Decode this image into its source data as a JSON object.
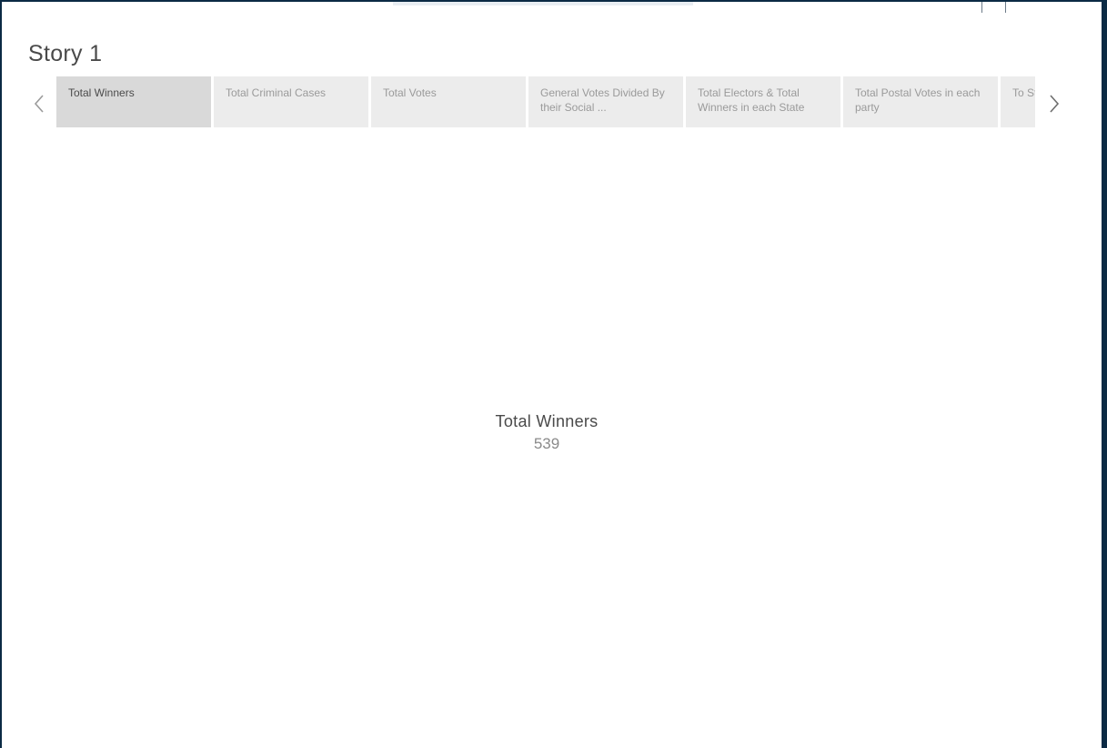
{
  "story": {
    "title": "Story 1"
  },
  "tabs": [
    {
      "label": "Total Winners",
      "active": true
    },
    {
      "label": "Total Criminal Cases",
      "active": false
    },
    {
      "label": "Total Votes",
      "active": false
    },
    {
      "label": "General Votes Divided By their Social ...",
      "active": false
    },
    {
      "label": "Total Electors & Total Winners in each State",
      "active": false
    },
    {
      "label": "Total Postal Votes in each party",
      "active": false
    },
    {
      "label": "To St",
      "active": false
    }
  ],
  "nav": {
    "prev_icon": "chevron-left-icon",
    "next_icon": "chevron-right-icon"
  },
  "kpi": {
    "label": "Total Winners",
    "value": "539"
  }
}
